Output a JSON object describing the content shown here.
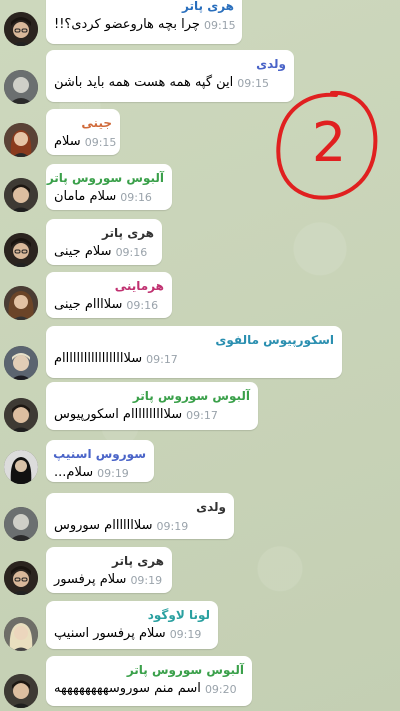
{
  "colors": {
    "background": "#c9d3b9",
    "bubble": "#ffffff",
    "time": "#9aa3ab",
    "annotation": "#e02020"
  },
  "annotation": {
    "text": "2"
  },
  "messages": [
    {
      "sender": "هری پاتر",
      "sender_color": "#2a6fbd",
      "text": "چرا بچه هاروعضو کردی؟!!",
      "time": "09:15",
      "avatar": "avatar-harry"
    },
    {
      "sender": "ولدی",
      "sender_color": "#4a64c8",
      "text": "این گپه همه هست همه باید باشن",
      "time": "09:15",
      "avatar": "avatar-voldy"
    },
    {
      "sender": "جینی",
      "sender_color": "#d06a3a",
      "text": "سلام",
      "time": "09:15",
      "avatar": "avatar-ginny"
    },
    {
      "sender": "آلبوس سوروس پاتر",
      "sender_color": "#3aa04a",
      "text": "سلام مامان",
      "time": "09:16",
      "avatar": "avatar-albus"
    },
    {
      "sender": "هری پاتر",
      "sender_color": "#333333",
      "text": "سلام جینی",
      "time": "09:16",
      "avatar": "avatar-harry"
    },
    {
      "sender": "هرماینی",
      "sender_color": "#c03070",
      "text": "سلاااام جینی",
      "time": "09:16",
      "avatar": "avatar-hermione"
    },
    {
      "sender": "اسکورپیوس مالفوی",
      "sender_color": "#2a8fb0",
      "text": "سلاااااااااااااااااام",
      "time": "09:17",
      "avatar": "avatar-scorpius"
    },
    {
      "sender": "آلبوس سوروس پاتر",
      "sender_color": "#3aa04a",
      "text": "سلاااااااااام اسکورپیوس",
      "time": "09:17",
      "avatar": "avatar-albus"
    },
    {
      "sender": "سوروس اسنیپ",
      "sender_color": "#4a64c8",
      "text": "سلام...",
      "time": "09:19",
      "avatar": "avatar-snape"
    },
    {
      "sender": "ولدی",
      "sender_color": "#333333",
      "text": "سلااااااام سوروس",
      "time": "09:19",
      "avatar": "avatar-voldy"
    },
    {
      "sender": "هری پاتر",
      "sender_color": "#333333",
      "text": "سلام پرفسور",
      "time": "09:19",
      "avatar": "avatar-harry"
    },
    {
      "sender": "لونا لاوگود",
      "sender_color": "#2aa0a0",
      "text": "سلام پرفسور اسنیپ",
      "time": "09:19",
      "avatar": "avatar-luna"
    },
    {
      "sender": "آلبوس سوروس پاتر",
      "sender_color": "#3aa04a",
      "text": "اسم منم سوروسههههههههه",
      "time": "09:20",
      "avatar": "avatar-albus"
    }
  ]
}
